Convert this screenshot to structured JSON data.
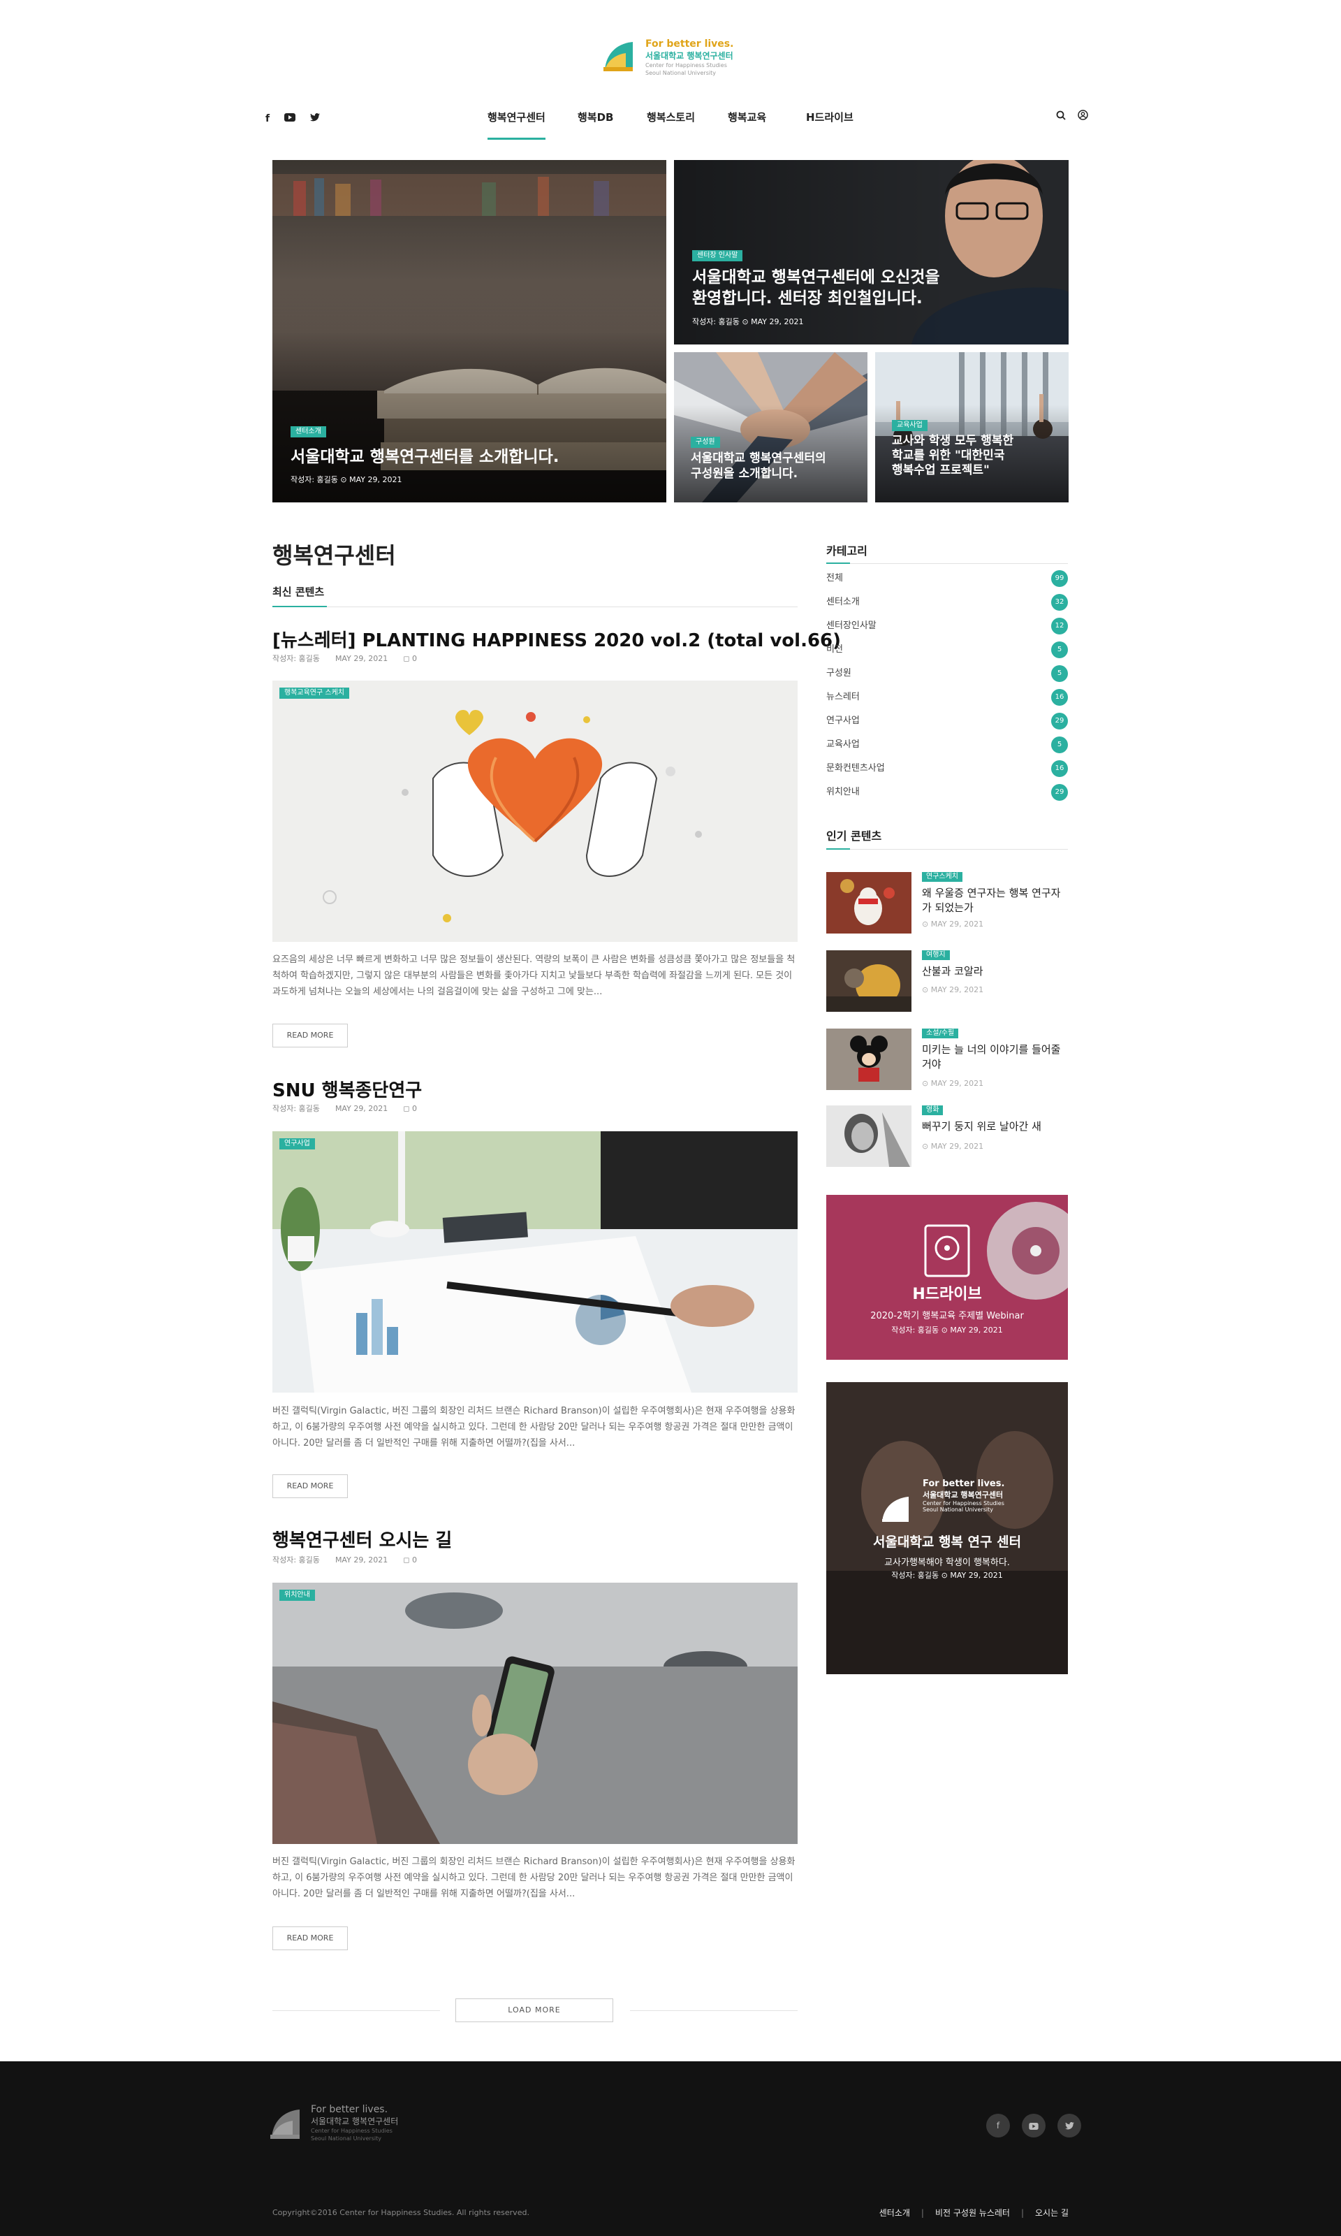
{
  "brand": {
    "tagline": "For better lives.",
    "name_ko": "서울대학교 행복연구센터",
    "name_en1": "Center for Happiness Studies",
    "name_en2": "Seoul National University"
  },
  "social": {
    "facebook": "f",
    "youtube": "▶",
    "twitter": "🐦"
  },
  "nav": {
    "items": [
      "행복연구센터",
      "행복DB",
      "행복스토리",
      "행복교육",
      "H드라이브"
    ],
    "active": 0
  },
  "header_icons": [
    "search-icon",
    "user-icon"
  ],
  "hero": {
    "main": {
      "badge": "센터소개",
      "title": "서울대학교 행복연구센터를 소개합니다.",
      "meta": "작성자: 홍길동  ⊙ MAY 29, 2021"
    },
    "top_right": {
      "badge": "센터장 인사말",
      "title_line1": "서울대학교 행복연구센터에 오신것을",
      "title_line2": "환영합니다. 센터장 최인철입니다.",
      "meta": "작성자: 홍길동  ⊙ MAY 29, 2021"
    },
    "bottom_left": {
      "badge": "구성원",
      "title_line1": "서울대학교 행복연구센터의",
      "title_line2": "구성원을 소개합니다."
    },
    "bottom_right": {
      "badge": "교육사업",
      "title_line1": "교사와 학생 모두 행복한",
      "title_line2": "학교를 위한 \"대한민국",
      "title_line3": "행복수업 프로젝트\""
    }
  },
  "main": {
    "title": "행복연구센터",
    "latest_label": "최신 콘텐츠",
    "read_more": "READ MORE",
    "load_more": "LOAD MORE",
    "posts": [
      {
        "title": "[뉴스레터] PLANTING HAPPINESS 2020 vol.2 (total vol.66)",
        "author": "작성자: 홍길동",
        "date": "MAY 29, 2021",
        "comments": "◻ 0",
        "badge": "행복교육연구 스케치",
        "excerpt": "요즈음의 세상은 너무 빠르게 변화하고 너무 많은 정보들이 생산된다. 역량의 보폭이 큰 사람은 변화를 성큼성큼 쫓아가고 많은 정보들을 척척하여 학습하겠지만, 그렇지 않은 대부분의 사람들은 변화를 좇아가다 지치고 낯들보다 부족한 학습력에 좌절감을 느끼게 된다. 모든 것이 과도하게 넘쳐나는 오늘의 세상에서는 나의 걸음걸이에 맞는 삶을 구성하고 그에 맞는..."
      },
      {
        "title": "SNU 행복종단연구",
        "author": "작성자: 홍길동",
        "date": "MAY 29, 2021",
        "comments": "◻ 0",
        "badge": "연구사업",
        "excerpt": "버진 갤럭틱(Virgin Galactic, 버진 그룹의 회장인 리처드 브랜슨 Richard Branson)이 설립한 우주여행회사)은 현재 우주여행을 상용화하고, 이 6붐가량의 우주여행 사전 예약을 실시하고 있다. 그런데 한 사람당 20만 달러나 되는 우주여행 항공권 가격은 절대 만만한 금액이 아니다. 20만 달러를 좀 더 일반적인 구매를 위해 지출하면 어떨까?(집을 사서..."
      },
      {
        "title": "행복연구센터 오시는 길",
        "author": "작성자: 홍길동",
        "date": "MAY 29, 2021",
        "comments": "◻ 0",
        "badge": "위치안내",
        "excerpt": "버진 갤럭틱(Virgin Galactic, 버진 그룹의 회장인 리처드 브랜슨 Richard Branson)이 설립한 우주여행회사)은 현재 우주여행을 상용화하고, 이 6붐가량의 우주여행 사전 예약을 실시하고 있다. 그런데 한 사람당 20만 달러나 되는 우주여행 항공권 가격은 절대 만만한 금액이 아니다. 20만 달러를 좀 더 일반적인 구매를 위해 지출하면 어떨까?(집을 사서..."
      }
    ]
  },
  "sidebar": {
    "categories_title": "카테고리",
    "categories": [
      {
        "name": "전체",
        "count": "99"
      },
      {
        "name": "센터소개",
        "count": "32"
      },
      {
        "name": "센터장인사말",
        "count": "12"
      },
      {
        "name": "비전",
        "count": "5"
      },
      {
        "name": "구성원",
        "count": "5"
      },
      {
        "name": "뉴스레터",
        "count": "16"
      },
      {
        "name": "연구사업",
        "count": "29"
      },
      {
        "name": "교육사업",
        "count": "5"
      },
      {
        "name": "문화컨텐츠사업",
        "count": "16"
      },
      {
        "name": "위치안내",
        "count": "29"
      }
    ],
    "popular_title": "인기 콘텐츠",
    "popular": [
      {
        "badge": "연구스케치",
        "title": "왜 우울증 연구자는 행복 연구자가 되었는가",
        "date": "⊙ MAY 29, 2021"
      },
      {
        "badge": "여행지",
        "title": "산불과 코알라",
        "date": "⊙ MAY 29, 2021"
      },
      {
        "badge": "소설/수필",
        "title": "미키는 늘 너의 이야기를 들어줄 거야",
        "date": "⊙ MAY 29, 2021"
      },
      {
        "badge": "영화",
        "title": "뻐꾸기 둥지 위로 날아간 새",
        "date": "⊙ MAY 29, 2021"
      }
    ],
    "banner1": {
      "title": "H드라이브",
      "subtitle": "2020-2학기 행복교육 주제별 Webinar",
      "meta": "작성자: 홍길동  ⊙ MAY 29, 2021"
    },
    "banner2": {
      "tagline": "For better lives.",
      "name_ko": "서울대학교 행복연구센터",
      "en1": "Center for Happiness Studies",
      "en2": "Seoul National University",
      "title": "서울대학교 행복 연구 센터",
      "subtitle": "교사가행복해야 학생이 행복하다.",
      "meta": "작성자: 홍길동  ⊙ MAY 29, 2021"
    }
  },
  "footer": {
    "tagline": "For better lives.",
    "name_ko": "서울대학교 행복연구센터",
    "en1": "Center for Happiness Studies",
    "en2": "Seoul National University",
    "copyright": "Copyright©2016 Center for Happiness Studies. All rights reserved.",
    "links": [
      "센터소개",
      "비전 구성원 뉴스레터",
      "오시는 길"
    ],
    "separator": "|"
  },
  "colors": {
    "accent": "#2bb0a0",
    "gold": "#e0a419",
    "footer_bg": "#121212"
  }
}
